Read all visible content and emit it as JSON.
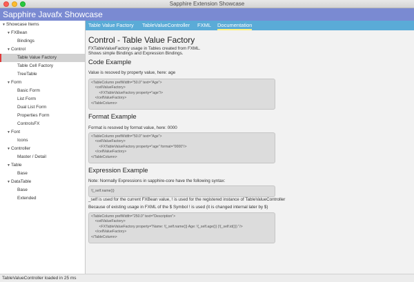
{
  "window": {
    "title": "Sapphire Extension Showcase"
  },
  "app": {
    "title": "Sapphire Javafx Showcase"
  },
  "tabs": [
    {
      "label": "Table Value Factory"
    },
    {
      "label": "TableValueController"
    },
    {
      "label": "FXML"
    },
    {
      "label": "Documentation"
    }
  ],
  "sidebar": {
    "items": [
      {
        "label": "Showcase Items",
        "expanded": true
      },
      {
        "label": "FXBean",
        "expanded": true
      },
      {
        "label": "Bindings"
      },
      {
        "label": "Control",
        "expanded": true
      },
      {
        "label": "Table Value Factory",
        "selected": true
      },
      {
        "label": "Table Cell Factory"
      },
      {
        "label": "TreeTable"
      },
      {
        "label": "Form",
        "expanded": true
      },
      {
        "label": "Basic Form"
      },
      {
        "label": "List Form"
      },
      {
        "label": "Dual List Form"
      },
      {
        "label": "Properties Form"
      },
      {
        "label": "ControlsFX"
      },
      {
        "label": "Font",
        "expanded": true
      },
      {
        "label": "Icons"
      },
      {
        "label": "Controller",
        "expanded": true
      },
      {
        "label": "Master / Detail"
      },
      {
        "label": "Table",
        "expanded": true
      },
      {
        "label": "Base"
      },
      {
        "label": "DataTable",
        "expanded": true
      },
      {
        "label": "Base"
      },
      {
        "label": "Extended"
      }
    ]
  },
  "content": {
    "title": "Control - Table Value Factory",
    "intro_line1": "FXTableValueFactory usage in Tables created from FXML.",
    "intro_line2": "Shows simple Bindings and Expression Bindings.",
    "code_example_heading": "Code Example",
    "code_example_desc": "Value is resoved by property value, here: age",
    "code_example_code": "<TableColumn prefWidth=\"50.0\" text=\"Age\">\n    <cellValueFactory>\n        <FXTableValueFactory property=\"age\"/>\n    </cellValueFactory>\n</TableColumn>",
    "format_example_heading": "Format Example",
    "format_example_desc": "Format is resoved by format value, here: 0000",
    "format_example_code": "<TableColumn prefWidth=\"50.0\" text=\"Age\">\n    <cellValueFactory>\n        <FXTableValueFactory property=\"age\" format=\"0000\"/>\n    </cellValueFactory>\n</TableColumn>",
    "expression_example_heading": "Expression Example",
    "expression_example_note": "Note: Normally Expressions in sapphire-core have the following syntax:",
    "expression_syntax_code": "!{_self.name()}",
    "expression_usage_text": "_self is used for the current FXBean value, ! is used for the registered instance of TableValueController",
    "expression_symbol_note": "Because of existing usage in FXML of the $ Symbol ! is used (it is changed internal later by $)",
    "expression_example_code": "<TableColumn prefWidth=\"250.0\" text=\"Description\">\n    <cellValueFactory>\n        <FXTableValueFactory property=\"Name: !{_self.name()} Age: !{_self.age()} (!{_self.id()}) \"/>\n    </cellValueFactory>\n</TableColumn>"
  },
  "status": {
    "text": "TableValueController loaded in 25 ms"
  },
  "colors": {
    "header": "#7a8ad2",
    "tabbar": "#5aabd7",
    "active_tab_underline": "#fff27a",
    "selection_marker": "#e03a3a"
  }
}
